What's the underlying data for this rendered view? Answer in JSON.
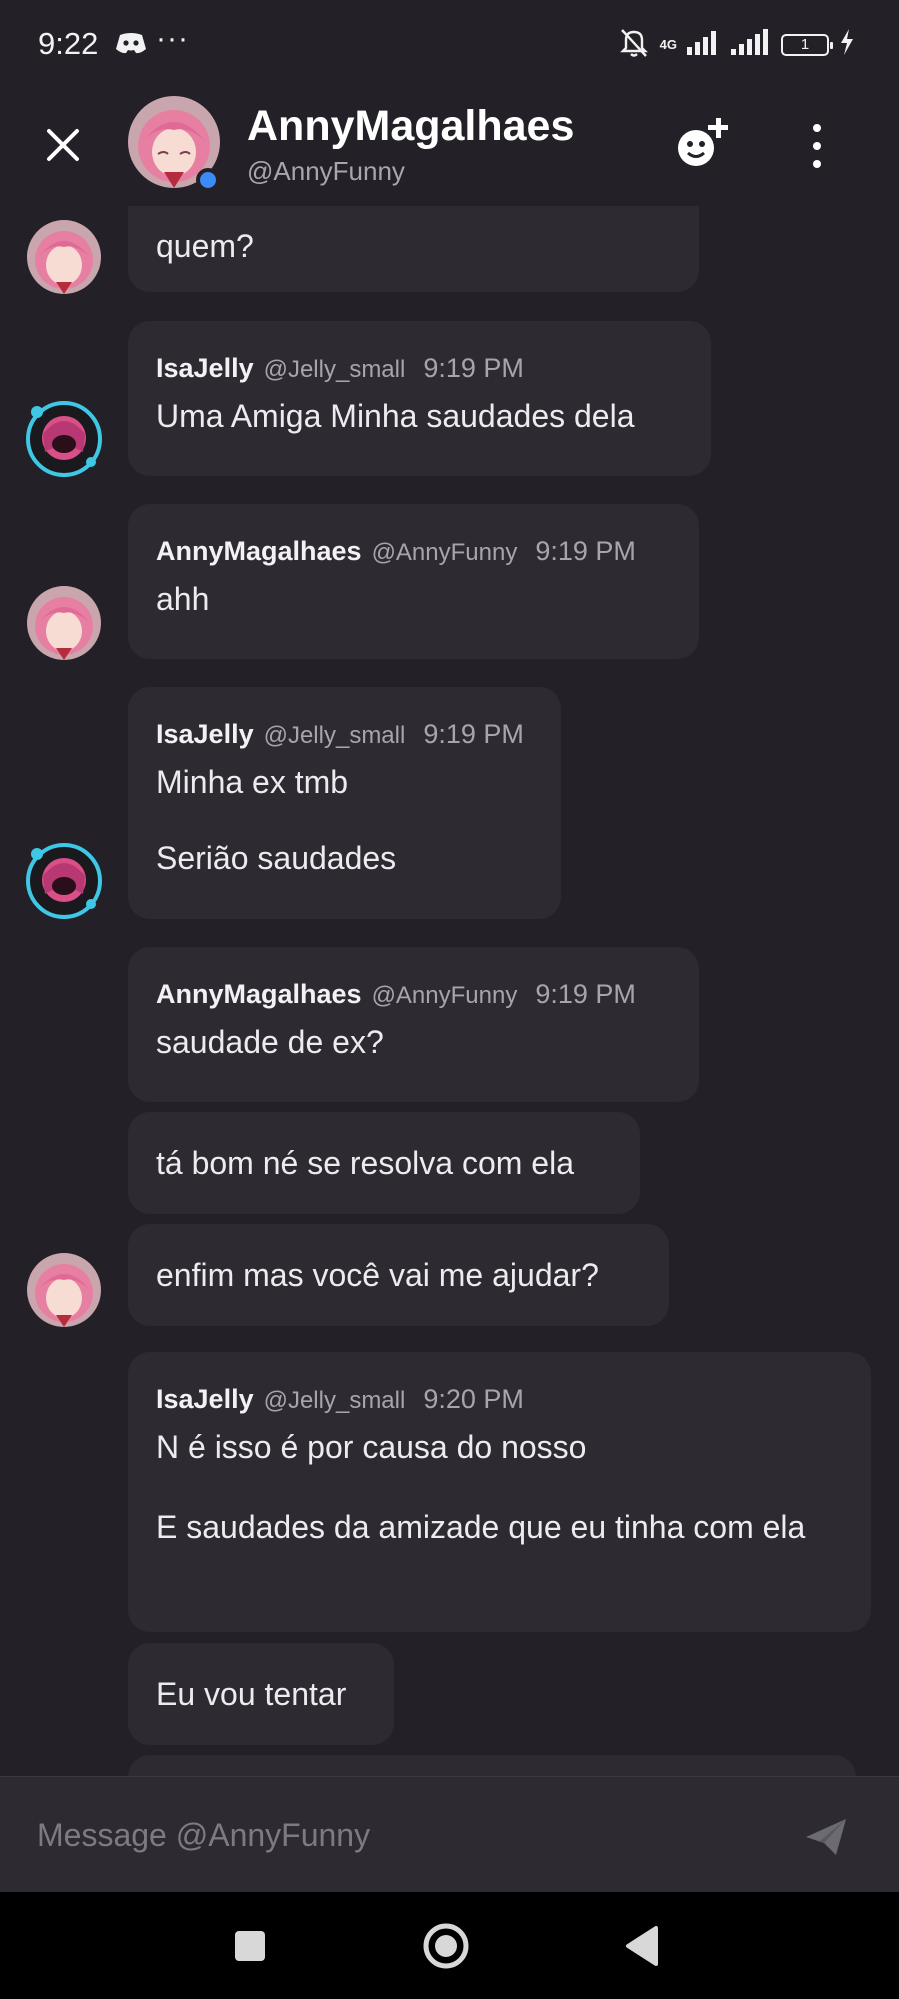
{
  "status_bar": {
    "time": "9:22",
    "dots": "···",
    "network": "4G",
    "battery": "1"
  },
  "header": {
    "name": "AnnyMagalhaes",
    "handle": "@AnnyFunny"
  },
  "messages": [
    {
      "text": "quem?"
    },
    {
      "author": "IsaJelly",
      "handle": "@Jelly_small",
      "time": "9:19 PM",
      "lines": [
        "Uma Amiga Minha saudades dela"
      ]
    },
    {
      "author": "AnnyMagalhaes",
      "handle": "@AnnyFunny",
      "time": "9:19 PM",
      "lines": [
        "ahh"
      ]
    },
    {
      "author": "IsaJelly",
      "handle": "@Jelly_small",
      "time": "9:19 PM",
      "lines": [
        "Minha ex tmb",
        "Serião saudades"
      ]
    },
    {
      "author": "AnnyMagalhaes",
      "handle": "@AnnyFunny",
      "time": "9:19 PM",
      "lines": [
        "saudade de ex?"
      ]
    },
    {
      "text": "tá bom né se resolva com ela"
    },
    {
      "text": "enfim mas você vai me ajudar?"
    },
    {
      "author": "IsaJelly",
      "handle": "@Jelly_small",
      "time": "9:20 PM",
      "lines": [
        "N é isso é por causa do nosso",
        "E saudades da amizade que eu tinha com ela"
      ]
    },
    {
      "text": "Eu vou tentar"
    }
  ],
  "composer": {
    "placeholder": "Message @AnnyFunny"
  },
  "colors": {
    "background": "#232127",
    "bubble": "#2d2b31",
    "online": "#3a8bf5",
    "isa_ring": "#3fc7e6"
  }
}
